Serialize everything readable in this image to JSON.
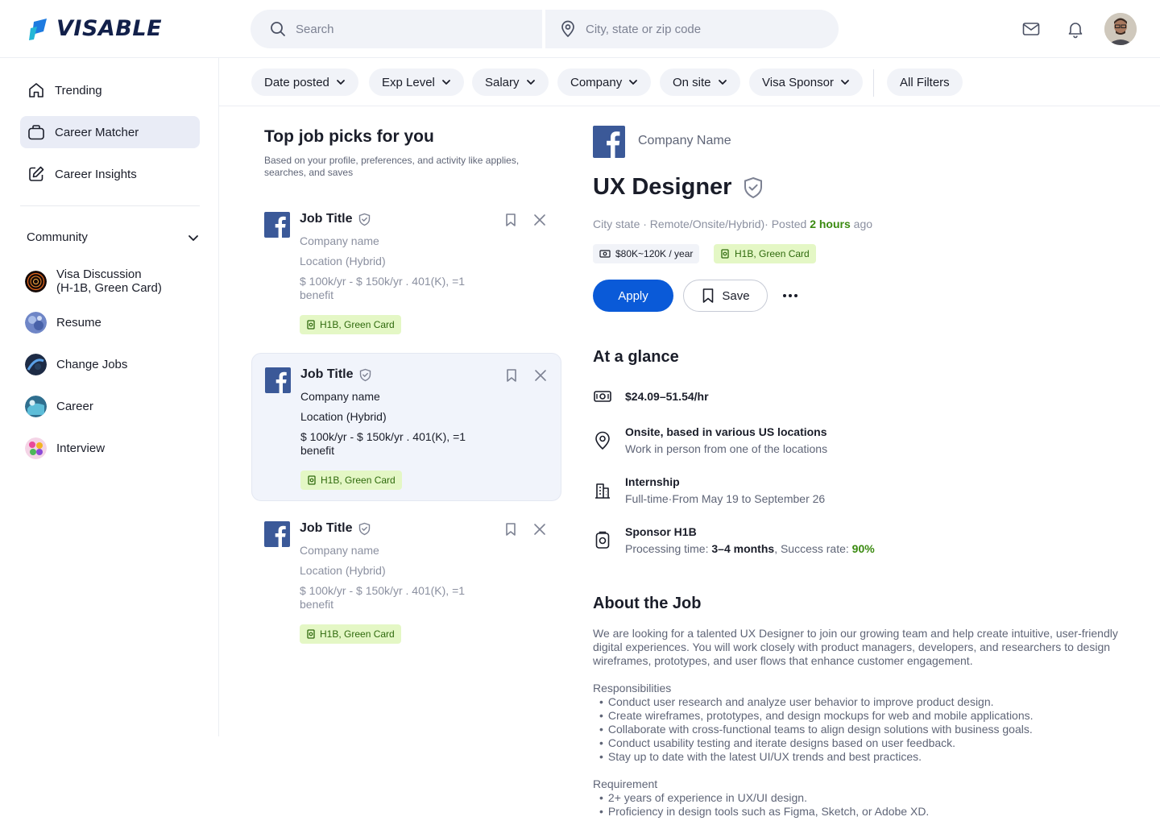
{
  "brand": {
    "name": "VISABLE",
    "colors": {
      "primary": "#0a5ad8",
      "green": "#3a8a10",
      "tag_bg": "#e4f7c5"
    }
  },
  "search": {
    "keyword_placeholder": "Search",
    "location_placeholder": "City, state or zip code"
  },
  "header_icons": [
    "mail-icon",
    "bell-icon",
    "user-avatar"
  ],
  "sidebar": {
    "items": [
      {
        "label": "Trending",
        "icon": "home-icon"
      },
      {
        "label": "Career Matcher",
        "icon": "briefcase-icon",
        "active": true
      },
      {
        "label": "Career Insights",
        "icon": "edit-icon"
      }
    ],
    "community": {
      "label": "Community",
      "items": [
        {
          "label_line1": "Visa Discussion",
          "label_line2": "(H-1B, Green Card)"
        },
        {
          "label": "Resume"
        },
        {
          "label": "Change Jobs"
        },
        {
          "label": "Career"
        },
        {
          "label": "Interview"
        }
      ]
    }
  },
  "filters": [
    "Date posted",
    "Exp Level",
    "Salary",
    "Company",
    "On site",
    "Visa Sponsor"
  ],
  "all_filters_label": "All Filters",
  "job_list": {
    "title": "Top job picks for you",
    "subtitle": "Based on your profile, preferences, and activity like applies, searches, and saves",
    "cards": [
      {
        "title": "Job Title",
        "company": "Company name",
        "location": "Location (Hybrid)",
        "salary_line1": "$ 100k/yr - $ 150k/yr  . 401(K), =1",
        "salary_line2": "benefit",
        "visa": "H1B, Green Card",
        "selected": false
      },
      {
        "title": "Job Title",
        "company": "Company name",
        "location": "Location (Hybrid)",
        "salary_line1": "$ 100k/yr - $ 150k/yr  . 401(K), =1",
        "salary_line2": "benefit",
        "visa": "H1B, Green Card",
        "selected": true
      },
      {
        "title": "Job Title",
        "company": "Company name",
        "location": "Location (Hybrid)",
        "salary_line1": "$ 100k/yr - $ 150k/yr  . 401(K), =1",
        "salary_line2": "benefit",
        "visa": "H1B, Green Card",
        "selected": false
      }
    ]
  },
  "detail": {
    "company": "Company Name",
    "title": "UX Designer",
    "meta_prefix": "City state · Remote/Onsite/Hybrid)· Posted",
    "meta_time": "2 hours",
    "meta_suffix": "ago",
    "salary_tag": "$80K~120K / year",
    "visa_tag": "H1B, Green Card",
    "apply_label": "Apply",
    "save_label": "Save",
    "glance_title": "At a glance",
    "glance": {
      "pay": "$24.09–51.54/hr",
      "location_main": "Onsite, based in various US locations",
      "location_sub": "Work in person from one of the locations",
      "type_main": "Internship",
      "type_sub": "Full-time·From May 19 to September 26",
      "sponsor_main": "Sponsor H1B",
      "sponsor_sub_prefix": "Processing time:",
      "sponsor_time": "3–4 months",
      "sponsor_mid": ", Success rate:",
      "sponsor_rate": "90%"
    },
    "about_title": "About the Job",
    "about_intro": "We are looking for a talented UX Designer to join our growing team and help create intuitive, user-friendly digital experiences. You will work closely with product managers, developers, and researchers to design wireframes, prototypes, and user flows that enhance customer engagement.",
    "responsibilities_title": "Responsibilities",
    "responsibilities": [
      "Conduct user research and analyze user behavior to improve product design.",
      "Create wireframes, prototypes, and design mockups for web and mobile applications.",
      "Collaborate with cross-functional teams to align design solutions with business goals.",
      "Conduct usability testing and iterate designs based on user feedback.",
      "Stay up to date with the latest UI/UX trends and best practices."
    ],
    "requirement_title": "Requirement",
    "requirements": [
      "2+ years of experience in UX/UI design.",
      "Proficiency in design tools such as Figma, Sketch, or Adobe XD."
    ]
  }
}
